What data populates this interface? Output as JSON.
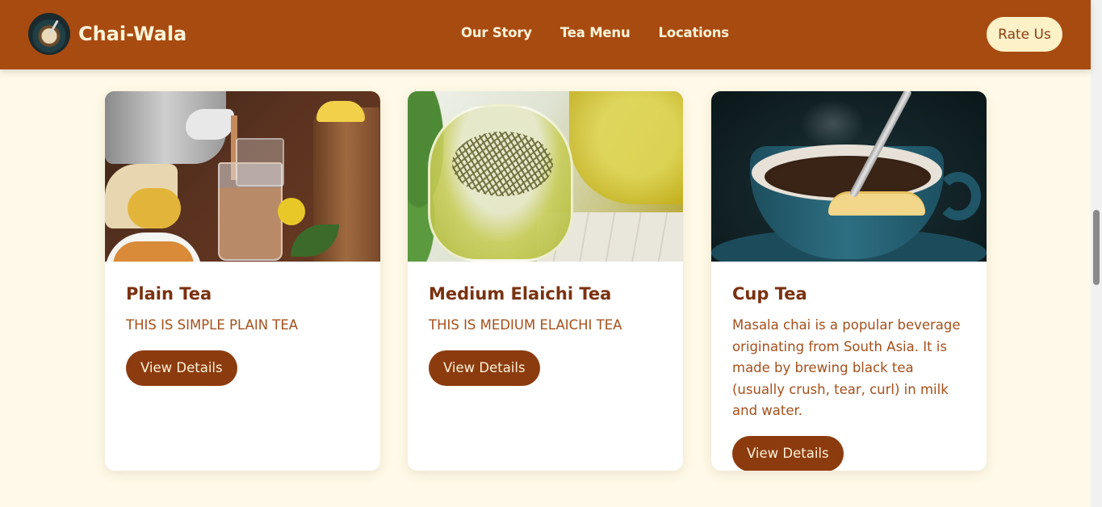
{
  "header": {
    "brand_name": "Chai-Wala",
    "nav": [
      {
        "label": "Our Story"
      },
      {
        "label": "Tea Menu"
      },
      {
        "label": "Locations"
      }
    ],
    "rate_label": "Rate Us"
  },
  "cards": [
    {
      "title": "Plain Tea",
      "description": "THIS IS SIMPLE PLAIN TEA",
      "button_label": "View Details",
      "image": "plain-tea-photo"
    },
    {
      "title": "Medium Elaichi Tea",
      "description": "THIS IS MEDIUM ELAICHI TEA",
      "button_label": "View Details",
      "image": "elaichi-tea-photo"
    },
    {
      "title": "Cup Tea",
      "description": "Masala chai is a popular beverage originating from South Asia. It is made by brewing black tea (usually crush, tear, curl) in milk and water.",
      "button_label": "View Details",
      "image": "cup-tea-photo"
    }
  ],
  "colors": {
    "header_bg": "#a84b10",
    "page_bg": "#fef9e8",
    "accent": "#8c3b0f",
    "title": "#7a3210",
    "text": "#a4501b",
    "rate_bg": "#fdf1c8"
  }
}
